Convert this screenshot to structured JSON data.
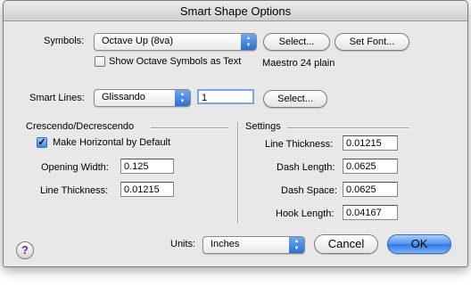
{
  "window": {
    "title": "Smart Shape Options"
  },
  "symbols": {
    "label": "Symbols:",
    "popup_value": "Octave  Up (8va)",
    "select_button": "Select...",
    "set_font_button": "Set Font...",
    "show_octave_label": "Show Octave Symbols as Text",
    "show_octave_checked": false,
    "font_info": "Maestro 24 plain"
  },
  "smart_lines": {
    "label": "Smart Lines:",
    "popup_value": "Glissando",
    "number_value": "1",
    "select_button": "Select..."
  },
  "crescendo": {
    "heading": "Crescendo/Decrescendo",
    "make_horizontal_label": "Make Horizontal by Default",
    "make_horizontal_checked": true,
    "opening_width_label": "Opening Width:",
    "opening_width_value": "0.125",
    "line_thickness_label": "Line Thickness:",
    "line_thickness_value": "0.01215"
  },
  "settings": {
    "heading": "Settings",
    "line_thickness_label": "Line Thickness:",
    "line_thickness_value": "0.01215",
    "dash_length_label": "Dash Length:",
    "dash_length_value": "0.0625",
    "dash_space_label": "Dash Space:",
    "dash_space_value": "0.0625",
    "hook_length_label": "Hook Length:",
    "hook_length_value": "0.04167"
  },
  "footer": {
    "help_glyph": "?",
    "units_label": "Units:",
    "units_value": "Inches",
    "cancel_button": "Cancel",
    "ok_button": "OK"
  },
  "icons": {
    "popup_arrows": "up-down-arrows-icon",
    "checkmark": "checkmark-icon",
    "help": "help-icon"
  },
  "colors": {
    "accent": "#3d86e8",
    "help_glyph": "#6b2d8f"
  }
}
